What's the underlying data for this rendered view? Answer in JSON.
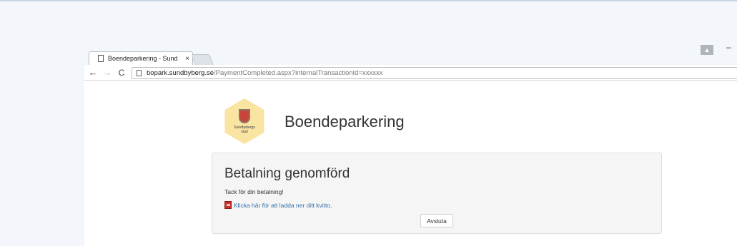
{
  "browser": {
    "tab_title": "Boendeparkering - Sund",
    "tab_close": "×",
    "url_host": "bopark.sundbyberg.se",
    "url_path": "/PaymentCompleted.aspx?internalTransactionId=xxxxxx",
    "icons": {
      "back": "←",
      "forward": "→",
      "reload": "C",
      "minimize": "–",
      "user": "▲"
    }
  },
  "page": {
    "logo_text_line1": "Sundbybergs",
    "logo_text_line2": "stad",
    "title": "Boendeparkering",
    "panel": {
      "heading": "Betalning genomförd",
      "thanks": "Tack för din betalning!",
      "receipt_link": "Klicka här för att ladda ner ditt kvitto.",
      "finish_button": "Avsluta"
    }
  },
  "colors": {
    "link": "#3071a9",
    "logo_bg": "#f9e4a1",
    "panel_bg": "#f5f5f5"
  }
}
